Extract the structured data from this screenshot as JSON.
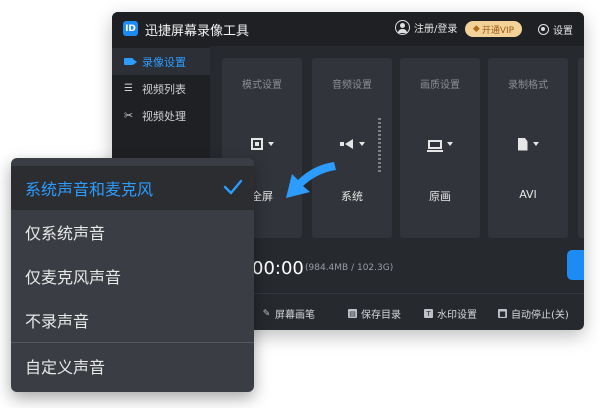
{
  "window": {
    "app_logo": "ID",
    "title": "迅捷屏幕录像工具",
    "login_label": "注册/登录",
    "vip_label": "开通VIP",
    "settings_label": "设置"
  },
  "sidebar": {
    "items": [
      {
        "label": "录像设置",
        "icon": "camera-icon",
        "active": true
      },
      {
        "label": "视频列表",
        "icon": "list-icon",
        "active": false
      },
      {
        "label": "视频处理",
        "icon": "process-icon",
        "active": false
      }
    ]
  },
  "cards": [
    {
      "title": "模式设置",
      "value": "全屏",
      "icon": "fullscreen-icon"
    },
    {
      "title": "音频设置",
      "value": "系统",
      "icon": "speaker-icon"
    },
    {
      "title": "画质设置",
      "value": "原画",
      "icon": "monitor-icon"
    },
    {
      "title": "录制格式",
      "value": "AVI",
      "icon": "file-icon"
    }
  ],
  "status": {
    "timer": "00:00",
    "size_info": "(984.4MB / 102.3G)"
  },
  "toolbar": {
    "items": [
      {
        "label": "屏幕画笔",
        "icon": "pen-icon"
      },
      {
        "label": "保存目录",
        "icon": "folder-icon"
      },
      {
        "label": "水印设置",
        "icon": "watermark-icon"
      },
      {
        "label": "自动停止(关)",
        "icon": "auto-stop-icon"
      }
    ]
  },
  "audio_dropdown": {
    "options": [
      {
        "label": "系统声音和麦克风",
        "selected": true
      },
      {
        "label": "仅系统声音",
        "selected": false
      },
      {
        "label": "仅麦克风声音",
        "selected": false
      },
      {
        "label": "不录声音",
        "selected": false
      },
      {
        "label": "自定义声音",
        "selected": false
      }
    ]
  },
  "colors": {
    "accent": "#2c9cff",
    "window_bg": "#26292e",
    "titlebar_bg": "#1e2024",
    "card_bg": "#31343a",
    "dropdown_bg": "#3a3d43",
    "vip_bg": "#f3d29a"
  }
}
